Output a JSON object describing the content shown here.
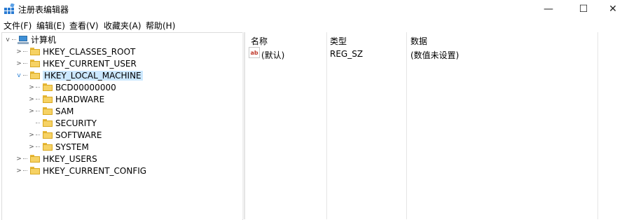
{
  "window": {
    "title": "注册表编辑器",
    "minimize": "—",
    "maximize": "☐",
    "close": "✕"
  },
  "menu": [
    "文件(F)",
    "编辑(E)",
    "查看(V)",
    "收藏夹(A)",
    "帮助(H)"
  ],
  "tree": {
    "root": {
      "label": "计算机",
      "expanded": true
    },
    "items": [
      {
        "label": "HKEY_CLASSES_ROOT",
        "level": 1,
        "expander": ">"
      },
      {
        "label": "HKEY_CURRENT_USER",
        "level": 1,
        "expander": ">"
      },
      {
        "label": "HKEY_LOCAL_MACHINE",
        "level": 1,
        "expander": "v",
        "selected": true
      },
      {
        "label": "BCD00000000",
        "level": 2,
        "expander": ">"
      },
      {
        "label": "HARDWARE",
        "level": 2,
        "expander": ">"
      },
      {
        "label": "SAM",
        "level": 2,
        "expander": ">"
      },
      {
        "label": "SECURITY",
        "level": 2,
        "expander": ""
      },
      {
        "label": "SOFTWARE",
        "level": 2,
        "expander": ">"
      },
      {
        "label": "SYSTEM",
        "level": 2,
        "expander": ">"
      },
      {
        "label": "HKEY_USERS",
        "level": 1,
        "expander": ">"
      },
      {
        "label": "HKEY_CURRENT_CONFIG",
        "level": 1,
        "expander": ">"
      }
    ]
  },
  "list": {
    "columns": {
      "name": "名称",
      "type": "类型",
      "data": "数据"
    },
    "rows": [
      {
        "icon": "ab",
        "name": "(默认)",
        "type": "REG_SZ",
        "data": "(数值未设置)"
      }
    ]
  }
}
